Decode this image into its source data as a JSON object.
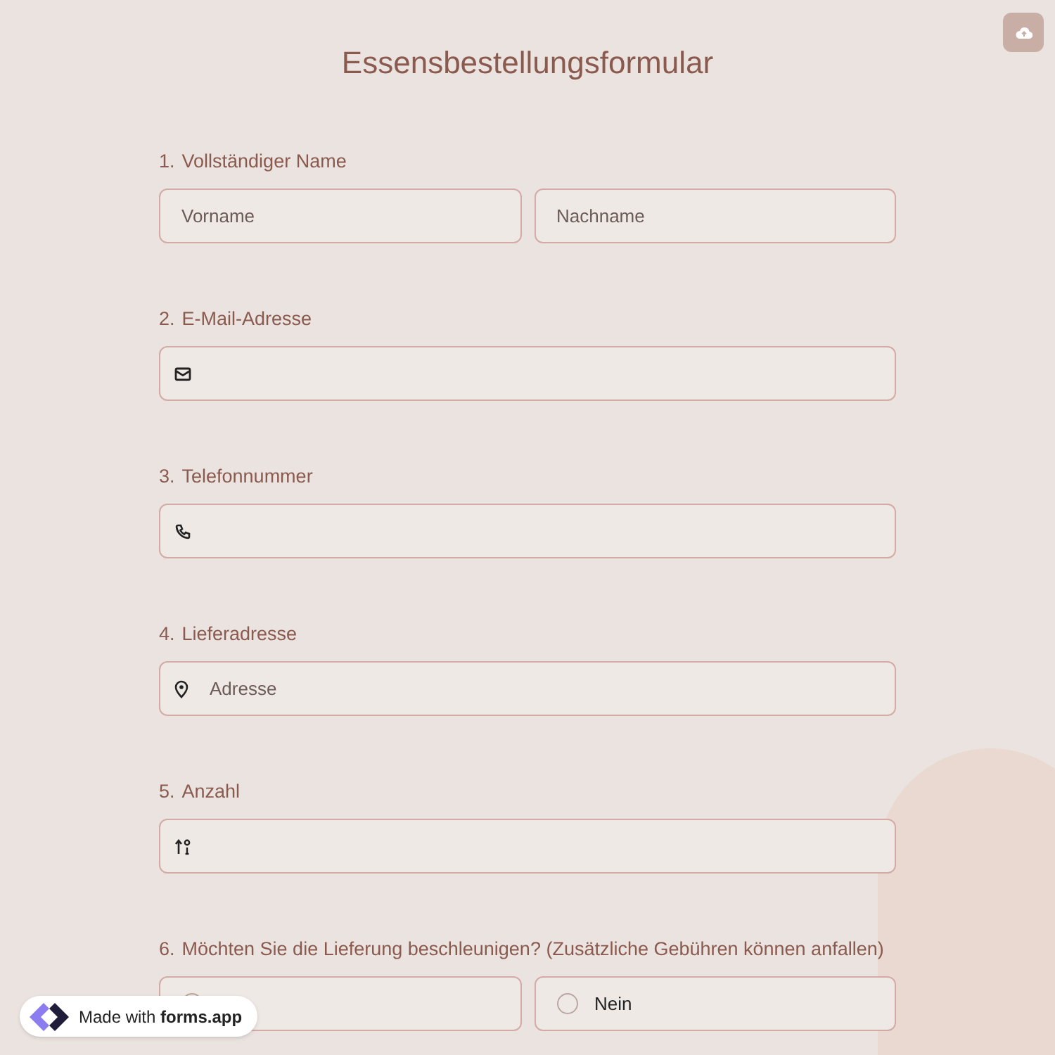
{
  "title": "Essensbestellungsformular",
  "questions": [
    {
      "kind": "name",
      "number": "1.",
      "label": "Vollständiger Name",
      "placeholders": [
        "Vorname",
        "Nachname"
      ]
    },
    {
      "kind": "email",
      "number": "2.",
      "label": "E-Mail-Adresse"
    },
    {
      "kind": "phone",
      "number": "3.",
      "label": "Telefonnummer"
    },
    {
      "kind": "address",
      "number": "4.",
      "label": "Lieferadresse",
      "placeholder": "Adresse"
    },
    {
      "kind": "number",
      "number": "5.",
      "label": "Anzahl"
    },
    {
      "kind": "radio",
      "number": "6.",
      "label": "Möchten Sie die Lieferung beschleunigen? (Zusätzliche Gebühren können anfallen)",
      "options": [
        {
          "selected": false
        },
        {
          "label": "Nein",
          "selected": false
        }
      ]
    }
  ],
  "badge": {
    "text": "Made with **forms.app**"
  }
}
